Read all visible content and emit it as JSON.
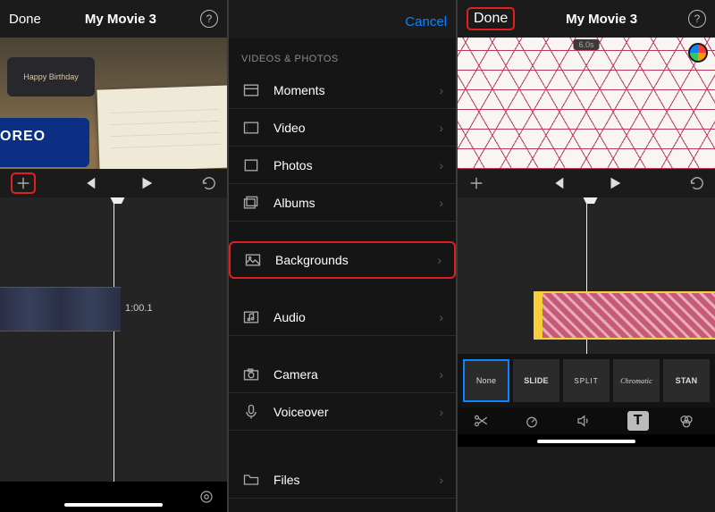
{
  "panel1": {
    "done": "Done",
    "title": "My Movie 3",
    "clip_time": "1:00.1"
  },
  "panel2": {
    "cancel": "Cancel",
    "section": "VIDEOS & PHOTOS",
    "items": [
      {
        "label": "Moments",
        "icon": "moments"
      },
      {
        "label": "Video",
        "icon": "video"
      },
      {
        "label": "Photos",
        "icon": "photos"
      },
      {
        "label": "Albums",
        "icon": "albums"
      },
      {
        "label": "Backgrounds",
        "icon": "backgrounds",
        "highlight": true
      },
      {
        "label": "Audio",
        "icon": "audio"
      },
      {
        "label": "Camera",
        "icon": "camera"
      },
      {
        "label": "Voiceover",
        "icon": "voiceover"
      },
      {
        "label": "Files",
        "icon": "files"
      }
    ]
  },
  "panel3": {
    "done": "Done",
    "title": "My Movie 3",
    "duration_pill": "6.0s",
    "effects": [
      {
        "label": "None",
        "style": "selected"
      },
      {
        "label": "SLIDE",
        "style": "bold"
      },
      {
        "label": "SPLIT",
        "style": "split"
      },
      {
        "label": "Chromatic",
        "style": "chromatic"
      },
      {
        "label": "STAN",
        "style": "bold"
      }
    ],
    "tools": [
      "scissors",
      "speed",
      "volume",
      "text",
      "filters"
    ]
  }
}
